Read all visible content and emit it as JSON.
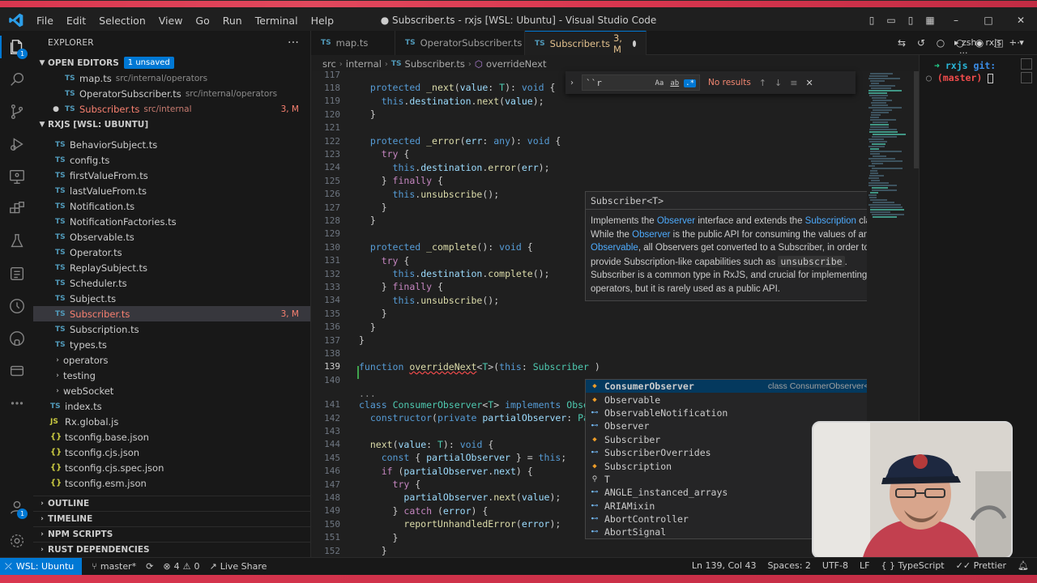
{
  "window": {
    "title": "● Subscriber.ts - rxjs [WSL: Ubuntu] - Visual Studio Code",
    "menu": [
      "File",
      "Edit",
      "Selection",
      "View",
      "Go",
      "Run",
      "Terminal",
      "Help"
    ]
  },
  "activity_bar": {
    "icons": [
      "explorer-icon",
      "search-icon",
      "source-control-icon",
      "run-debug-icon",
      "remote-explorer-icon",
      "extensions-icon",
      "testing-icon",
      "tests-icon",
      "timeline-icon",
      "github-icon",
      "docker-icon",
      "more-icon"
    ],
    "explorer_badge": "1",
    "accounts_badge": "1"
  },
  "sidebar": {
    "title": "EXPLORER",
    "open_editors": {
      "label": "OPEN EDITORS",
      "badge": "1 unsaved",
      "items": [
        {
          "name": "map.ts",
          "desc": "src/internal/operators",
          "status": ""
        },
        {
          "name": "OperatorSubscriber.ts",
          "desc": "src/internal/operators",
          "status": ""
        },
        {
          "name": "Subscriber.ts",
          "desc": "src/internal",
          "status": "3, M"
        }
      ]
    },
    "workspace": {
      "label": "RXJS [WSL: UBUNTU]",
      "files": [
        {
          "name": "BehaviorSubject.ts",
          "status": ""
        },
        {
          "name": "config.ts",
          "status": ""
        },
        {
          "name": "firstValueFrom.ts",
          "status": ""
        },
        {
          "name": "lastValueFrom.ts",
          "status": ""
        },
        {
          "name": "Notification.ts",
          "status": ""
        },
        {
          "name": "NotificationFactories.ts",
          "status": ""
        },
        {
          "name": "Observable.ts",
          "status": ""
        },
        {
          "name": "Operator.ts",
          "status": ""
        },
        {
          "name": "ReplaySubject.ts",
          "status": ""
        },
        {
          "name": "Scheduler.ts",
          "status": ""
        },
        {
          "name": "Subject.ts",
          "status": ""
        },
        {
          "name": "Subscriber.ts",
          "status": "3, M"
        },
        {
          "name": "Subscription.ts",
          "status": ""
        },
        {
          "name": "types.ts",
          "status": ""
        }
      ],
      "folders": [
        "operators",
        "testing",
        "webSocket"
      ],
      "root_files": [
        {
          "name": "index.ts",
          "kind": "ts"
        },
        {
          "name": "Rx.global.js",
          "kind": "js"
        },
        {
          "name": "tsconfig.base.json",
          "kind": "json"
        },
        {
          "name": "tsconfig.cjs.json",
          "kind": "json"
        },
        {
          "name": "tsconfig.cjs.spec.json",
          "kind": "json"
        },
        {
          "name": "tsconfig.esm.json",
          "kind": "json"
        }
      ]
    },
    "bottom_sections": [
      "OUTLINE",
      "TIMELINE",
      "NPM SCRIPTS",
      "RUST DEPENDENCIES"
    ]
  },
  "tabs": [
    {
      "label": "map.ts",
      "status": ""
    },
    {
      "label": "OperatorSubscriber.ts",
      "status": ""
    },
    {
      "label": "Subscriber.ts",
      "status": "3, M"
    }
  ],
  "breadcrumb": [
    "src",
    "internal",
    "Subscriber.ts",
    "overrideNext"
  ],
  "find": {
    "value": "``r",
    "options": [
      "Aa",
      "ab",
      ".*"
    ],
    "result": "No results"
  },
  "code": {
    "lines": [
      {
        "n": "117",
        "text": ""
      },
      {
        "n": "118",
        "text": "  protected _next(value: T): void {"
      },
      {
        "n": "119",
        "text": "    this.destination.next(value);"
      },
      {
        "n": "120",
        "text": "  }"
      },
      {
        "n": "121",
        "text": ""
      },
      {
        "n": "122",
        "text": "  protected _error(err: any): void {"
      },
      {
        "n": "123",
        "text": "    try {"
      },
      {
        "n": "124",
        "text": "      this.destination.error(err);"
      },
      {
        "n": "125",
        "text": "    } finally {"
      },
      {
        "n": "126",
        "text": "      this.unsubscribe();"
      },
      {
        "n": "127",
        "text": "    }"
      },
      {
        "n": "128",
        "text": "  }"
      },
      {
        "n": "129",
        "text": ""
      },
      {
        "n": "130",
        "text": "  protected _complete(): void {"
      },
      {
        "n": "131",
        "text": "    try {"
      },
      {
        "n": "132",
        "text": "      this.destination.complete();"
      },
      {
        "n": "133",
        "text": "    } finally {"
      },
      {
        "n": "134",
        "text": "      this.unsubscribe();"
      },
      {
        "n": "135",
        "text": "    }"
      },
      {
        "n": "136",
        "text": "  }"
      },
      {
        "n": "137",
        "text": "}"
      },
      {
        "n": "138",
        "text": ""
      },
      {
        "n": "139",
        "text": "function overrideNext<T>(this: Subscriber )"
      },
      {
        "n": "140",
        "text": ""
      },
      {
        "n": "",
        "text": "..."
      },
      {
        "n": "141",
        "text": "class ConsumerObserver<T> implements Obser"
      },
      {
        "n": "142",
        "text": "  constructor(private partialObserver: Par"
      },
      {
        "n": "143",
        "text": ""
      },
      {
        "n": "144",
        "text": "  next(value: T): void {"
      },
      {
        "n": "145",
        "text": "    const { partialObserver } = this;"
      },
      {
        "n": "146",
        "text": "    if (partialObserver.next) {"
      },
      {
        "n": "147",
        "text": "      try {"
      },
      {
        "n": "148",
        "text": "        partialObserver.next(value);"
      },
      {
        "n": "149",
        "text": "      } catch (error) {"
      },
      {
        "n": "150",
        "text": "        reportUnhandledError(error);"
      },
      {
        "n": "151",
        "text": "      }"
      },
      {
        "n": "152",
        "text": "    }"
      }
    ]
  },
  "hover": {
    "signature": "Subscriber<T>",
    "doc_parts": [
      "Implements the ",
      "Observer",
      " interface and extends the ",
      "Subscription",
      " class. While the ",
      "Observer",
      " is the public API for consuming the values of an ",
      "Observable",
      ", all Observers get converted to a Subscriber, in order to provide Subscription-like capabilities such as ",
      "unsubscribe",
      ". Subscriber is a common type in RxJS, and crucial for implementing operators, but it is rarely used as a public API."
    ]
  },
  "suggest": {
    "items": [
      {
        "label": "ConsumerObserver",
        "kind": "class",
        "detail": "class ConsumerObserver<T>"
      },
      {
        "label": "Observable",
        "kind": "class",
        "detail": ""
      },
      {
        "label": "ObservableNotification",
        "kind": "type",
        "detail": ""
      },
      {
        "label": "Observer",
        "kind": "interface",
        "detail": ""
      },
      {
        "label": "Subscriber",
        "kind": "class",
        "detail": ""
      },
      {
        "label": "SubscriberOverrides",
        "kind": "interface",
        "detail": ""
      },
      {
        "label": "Subscription",
        "kind": "class",
        "detail": ""
      },
      {
        "label": "T",
        "kind": "type-param",
        "detail": ""
      },
      {
        "label": "ANGLE_instanced_arrays",
        "kind": "interface",
        "detail": ""
      },
      {
        "label": "ARIAMixin",
        "kind": "interface",
        "detail": ""
      },
      {
        "label": "AbortController",
        "kind": "interface",
        "detail": ""
      },
      {
        "label": "AbortSignal",
        "kind": "interface",
        "detail": ""
      }
    ]
  },
  "terminal": {
    "tab_label": "zsh - rxjs",
    "prompt_arrow": "➜",
    "prompt_dir": "rxjs",
    "prompt_git": "git:",
    "prompt_branch": "(master)"
  },
  "status_bar": {
    "remote": "WSL: Ubuntu",
    "branch": "master*",
    "errors": "4",
    "warnings": "0",
    "live_share": "Live Share",
    "position": "Ln 139, Col 43",
    "spaces": "Spaces: 2",
    "encoding": "UTF-8",
    "eol": "LF",
    "language": "TypeScript",
    "formatter": "Prettier"
  },
  "colors": {
    "accent": "#0078d4",
    "title_gradient": "#d9364f",
    "modified": "#e2c08d"
  }
}
